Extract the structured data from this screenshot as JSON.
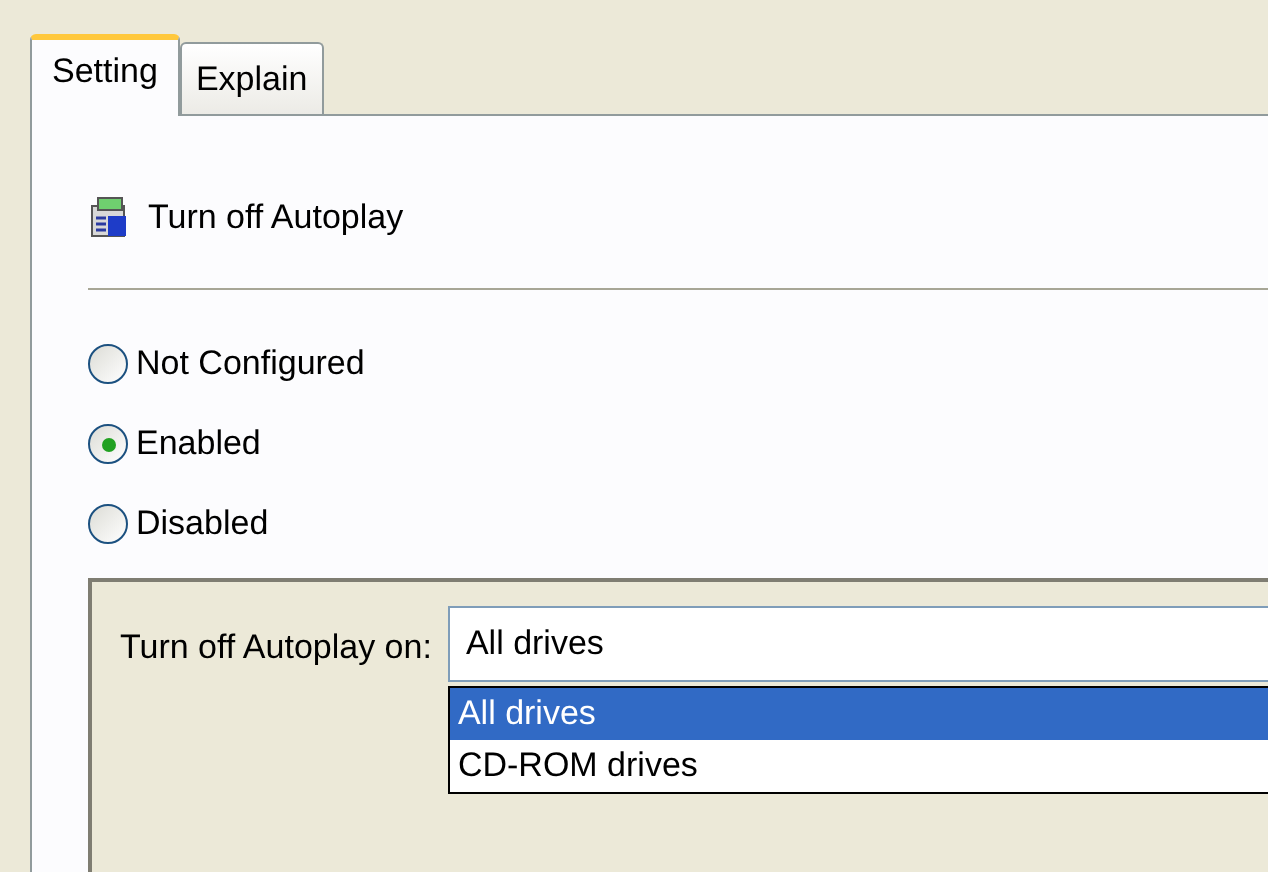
{
  "tabs": [
    {
      "label": "Setting",
      "selected": true
    },
    {
      "label": "Explain",
      "selected": false
    }
  ],
  "policy_title": "Turn off Autoplay",
  "options": [
    {
      "label": "Not Configured",
      "selected": false
    },
    {
      "label": "Enabled",
      "selected": true
    },
    {
      "label": "Disabled",
      "selected": false
    }
  ],
  "options_group": {
    "label": "Turn off Autoplay on:",
    "value": "All drives",
    "dropdown_items": [
      {
        "label": "All drives",
        "selected": true
      },
      {
        "label": "CD-ROM drives",
        "selected": false
      }
    ]
  }
}
